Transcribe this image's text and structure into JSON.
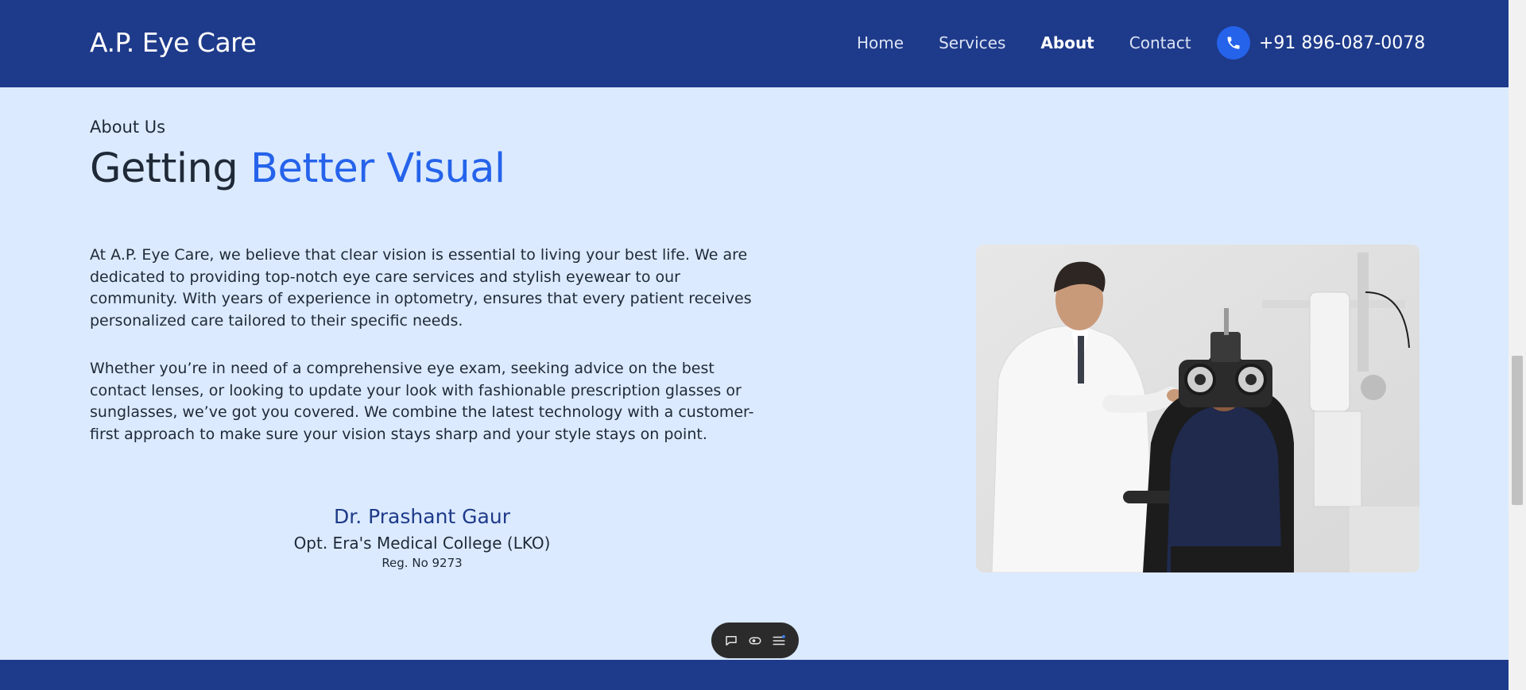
{
  "header": {
    "logo": "A.P. Eye Care",
    "nav": [
      {
        "label": "Home",
        "active": false
      },
      {
        "label": "Services",
        "active": false
      },
      {
        "label": "About",
        "active": true
      },
      {
        "label": "Contact",
        "active": false
      }
    ],
    "phone": {
      "icon": "phone-icon",
      "number": "+91 896-087-0078"
    }
  },
  "about": {
    "eyebrow": "About Us",
    "title_plain": "Getting",
    "title_accent": "Better Visual",
    "paragraphs": [
      "At A.P. Eye Care, we believe that clear vision is essential to living your best life. We are dedicated to providing top-notch eye care services and stylish eyewear to our community. With years of experience in optometry, ensures that every patient receives personalized care tailored to their specific needs.",
      "Whether you’re in need of a comprehensive eye exam, seeking advice on the best contact lenses, or looking to update your look with fashionable prescription glasses or sunglasses, we’ve got you covered. We combine the latest technology with a customer-first approach to make sure your vision stays sharp and your style stays on point."
    ],
    "doctor": {
      "name": "Dr. Prashant Gaur",
      "college": "Opt. Era's Medical College (LKO)",
      "reg": "Reg. No 9273"
    },
    "image": "optometrist-eye-exam-photo"
  },
  "toolbar": {
    "buttons": [
      "comment-icon",
      "eye-toggle-icon",
      "menu-icon"
    ]
  },
  "colors": {
    "header_bg": "#1e3a8a",
    "page_bg": "#dbeafe",
    "accent": "#2563eb",
    "text": "#1f2937"
  }
}
